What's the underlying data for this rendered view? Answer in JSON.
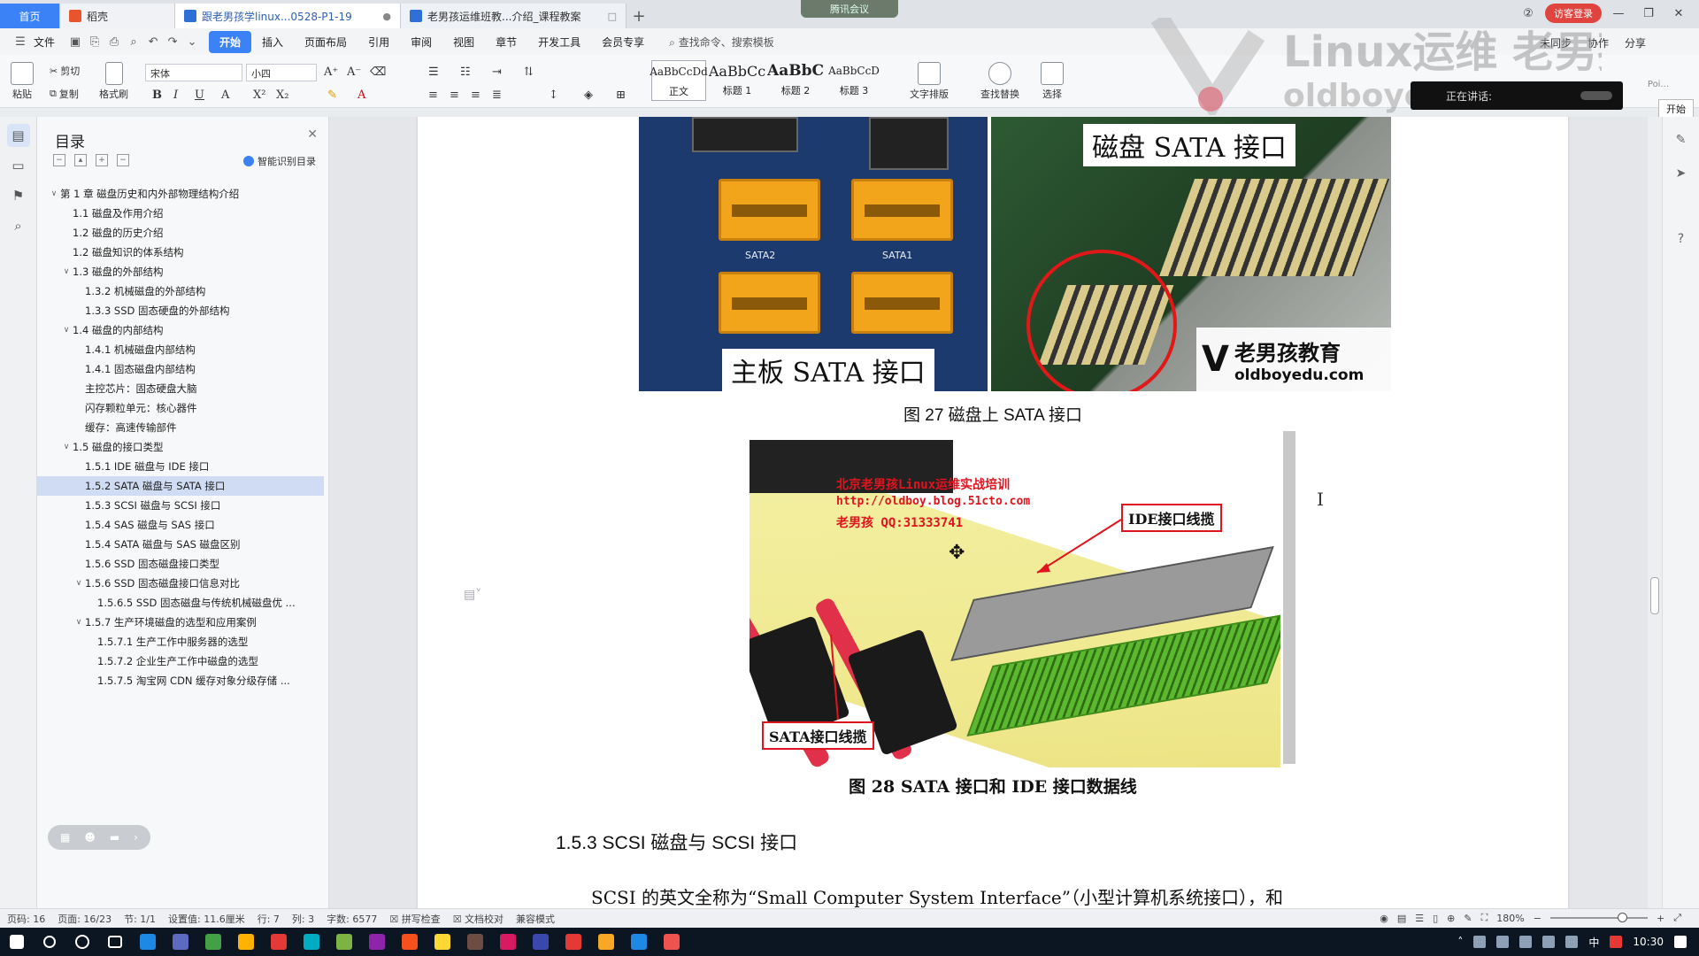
{
  "tabs": [
    {
      "label": "首页",
      "kind": "home"
    },
    {
      "label": "稻壳",
      "kind": "daoke"
    },
    {
      "label": "跟老男孩学linux...0528-P1-19",
      "kind": "doc"
    },
    {
      "label": "老男孩运维班教...介绍_课程教案",
      "kind": "doc2"
    }
  ],
  "meeting_label": "腾讯会议",
  "guest_login": "访客登录",
  "menu": {
    "file": "文件",
    "items": [
      "开始",
      "插入",
      "页面布局",
      "引用",
      "审阅",
      "视图",
      "章节",
      "开发工具",
      "会员专享"
    ],
    "active": "开始",
    "command_search": "查找命令、搜索模板",
    "right": [
      "未同步",
      "协作",
      "分享"
    ]
  },
  "ribbon": {
    "paste": "粘贴",
    "cut": "剪切",
    "copy": "复制",
    "format_painter": "格式刷",
    "font_name": "宋体",
    "font_size": "小四",
    "styles": [
      {
        "sample": "AaBbCcDd",
        "name": "正文"
      },
      {
        "sample": "AaBbCc",
        "name": "标题 1"
      },
      {
        "sample": "AaBbC",
        "name": "标题 2"
      },
      {
        "sample": "AaBbCcD",
        "name": "标题 3"
      }
    ],
    "text_layout": "文字排版",
    "find_replace": "查找替换",
    "select": "选择"
  },
  "overlay": {
    "watermark_text": "Linux运维 老男孩教育",
    "watermark_url": "oldboyedu.com",
    "speaking": "正在讲话:",
    "start_btn": "开始",
    "poi": "Poi..."
  },
  "toc": {
    "title": "目录",
    "smart": "智能识别目录",
    "items": [
      {
        "label": "第 1 章   磁盘历史和内外部物理结构介绍",
        "level": 0,
        "expand": "open"
      },
      {
        "label": "1.1 磁盘及作用介绍",
        "level": 1,
        "expand": ""
      },
      {
        "label": "1.2  磁盘的历史介绍",
        "level": 1,
        "expand": ""
      },
      {
        "label": "1.2 磁盘知识的体系结构",
        "level": 1,
        "expand": ""
      },
      {
        "label": "1.3 磁盘的外部结构",
        "level": 1,
        "expand": "open"
      },
      {
        "label": "1.3.2  机械磁盘的外部结构",
        "level": 2,
        "expand": ""
      },
      {
        "label": "1.3.3 SSD 固态硬盘的外部结构",
        "level": 2,
        "expand": ""
      },
      {
        "label": "1.4 磁盘的内部结构",
        "level": 1,
        "expand": "open"
      },
      {
        "label": "1.4.1 机械磁盘内部结构",
        "level": 2,
        "expand": ""
      },
      {
        "label": "1.4.1 固态磁盘内部结构",
        "level": 2,
        "expand": ""
      },
      {
        "label": "主控芯片：固态硬盘大脑",
        "level": 2,
        "expand": ""
      },
      {
        "label": "闪存颗粒单元：核心器件",
        "level": 2,
        "expand": ""
      },
      {
        "label": "缓存：高速传输部件",
        "level": 2,
        "expand": ""
      },
      {
        "label": "1.5 磁盘的接口类型",
        "level": 1,
        "expand": "open"
      },
      {
        "label": "1.5.1 IDE 磁盘与 IDE 接口",
        "level": 2,
        "expand": ""
      },
      {
        "label": "1.5.2 SATA 磁盘与 SATA 接口",
        "level": 2,
        "expand": "",
        "selected": true
      },
      {
        "label": "1.5.3 SCSI 磁盘与 SCSI 接口",
        "level": 2,
        "expand": ""
      },
      {
        "label": "1.5.4 SAS 磁盘与 SAS 接口",
        "level": 2,
        "expand": ""
      },
      {
        "label": "1.5.4 SATA 磁盘与 SAS 磁盘区别",
        "level": 2,
        "expand": ""
      },
      {
        "label": "1.5.6 SSD 固态磁盘接口类型",
        "level": 2,
        "expand": ""
      },
      {
        "label": "1.5.6 SSD 固态磁盘接口信息对比",
        "level": 2,
        "expand": "open"
      },
      {
        "label": "1.5.6.5 SSD 固态磁盘与传统机械磁盘优 ...",
        "level": 3,
        "expand": ""
      },
      {
        "label": "1.5.7 生产环境磁盘的选型和应用案例",
        "level": 2,
        "expand": "open"
      },
      {
        "label": "1.5.7.1 生产工作中服务器的选型",
        "level": 3,
        "expand": ""
      },
      {
        "label": "1.5.7.2  企业生产工作中磁盘的选型",
        "level": 3,
        "expand": ""
      },
      {
        "label": "1.5.7.5 淘宝网 CDN 缓存对象分级存储 ...",
        "level": 3,
        "expand": ""
      }
    ]
  },
  "document": {
    "fig27": {
      "left_label": "主板 SATA 接口",
      "right_label": "磁盘 SATA 接口",
      "logo_cn": "老男孩教育",
      "logo_url": "oldboyedu.com",
      "board_marks": [
        "SATA2",
        "SATA1"
      ],
      "caption": "图 27 磁盘上 SATA 接口"
    },
    "fig28": {
      "line1": "北京老男孩Linux运维实战培训",
      "line2": "http://oldboy.blog.51cto.com",
      "line3": "老男孩 QQ:31333741",
      "ide_label": "IDE接口线揽",
      "sata_label": "SATA接口线揽",
      "caption": "图 28 SATA 接口和 IDE 接口数据线"
    },
    "heading": "1.5.3 SCSI 磁盘与 SCSI 接口",
    "body": "SCSI 的英文全称为“Small Computer System Interface”（小型计算机系统接口），和"
  },
  "status": {
    "items": [
      "页码: 16",
      "页面: 16/23",
      "节: 1/1",
      "设置值: 11.6厘米",
      "行: 7",
      "列: 3",
      "字数: 6577",
      "拼写检查",
      "文档校对",
      "兼容模式"
    ],
    "zoom": "180%"
  },
  "taskbar": {
    "time": "10:30",
    "ime": "中",
    "icon_colors": [
      "#1e88e5",
      "#5c6bc0",
      "#43a047",
      "#ffb300",
      "#e53935",
      "#00acc1",
      "#7cb342",
      "#8e24aa",
      "#f4511e",
      "#fdd835",
      "#6d4c41",
      "#d81b60",
      "#3949ab",
      "#e53935",
      "#f9a825",
      "#1e88e5",
      "#ef5350"
    ]
  }
}
